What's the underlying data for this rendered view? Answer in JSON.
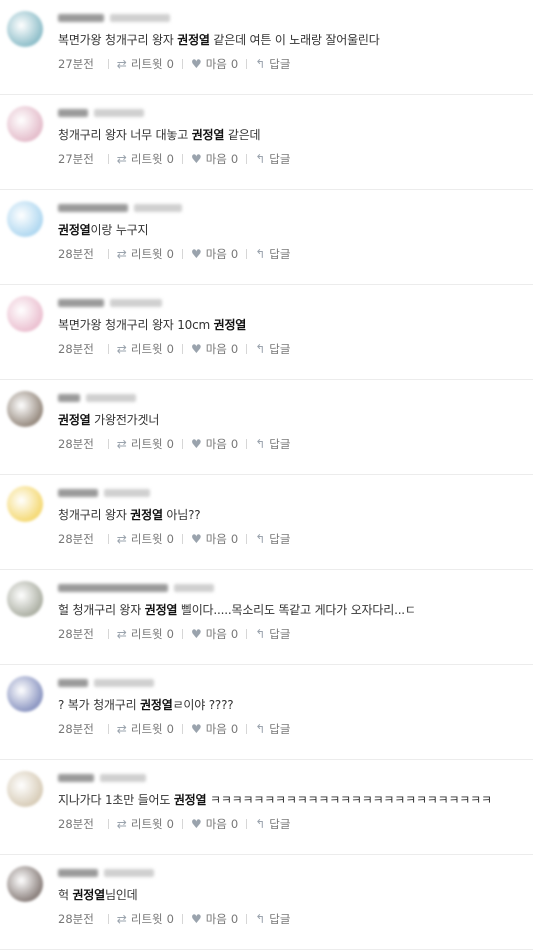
{
  "actions": {
    "retweet_label": "리트윗",
    "like_label": "마음",
    "reply_label": "답글"
  },
  "tweets": [
    {
      "time": "27분전",
      "pre": "복면가왕 청개구리 왕자 ",
      "bold": "권정열",
      "post": " 같은데 여튼 이 노래랑 잘어울린다",
      "retweets": "0",
      "likes": "0",
      "avatar": "#5fa3b3"
    },
    {
      "time": "27분전",
      "pre": "청개구리 왕자 너무 대놓고 ",
      "bold": "권정열",
      "post": " 같은데",
      "retweets": "0",
      "likes": "0",
      "avatar": "#d9a1b5"
    },
    {
      "time": "28분전",
      "pre": "",
      "bold": "권정열",
      "post": "이랑 누구지",
      "retweets": "0",
      "likes": "0",
      "avatar": "#8ec7ea"
    },
    {
      "time": "28분전",
      "pre": "복면가왕 청개구리 왕자 10cm ",
      "bold": "권정열",
      "post": "",
      "retweets": "0",
      "likes": "0",
      "avatar": "#e3a6bd"
    },
    {
      "time": "28분전",
      "pre": "",
      "bold": "권정열",
      "post": " 가왕전가겟너",
      "retweets": "0",
      "likes": "0",
      "avatar": "#6b5a4a"
    },
    {
      "time": "28분전",
      "pre": "청개구리 왕자 ",
      "bold": "권정열",
      "post": " 아님??",
      "retweets": "0",
      "likes": "0",
      "avatar": "#f0c93a"
    },
    {
      "time": "28분전",
      "pre": "헐 청개구리 왕자 ",
      "bold": "권정열",
      "post": " 삘이다.....목소리도 똑같고 게다가 오자다리...ㄷ",
      "retweets": "0",
      "likes": "0",
      "avatar": "#8a8f7e"
    },
    {
      "time": "28분전",
      "pre": "? 복가 청개구리 ",
      "bold": "권정열",
      "post": "ㄹ이야 ????",
      "retweets": "0",
      "likes": "0",
      "avatar": "#5b6aa8"
    },
    {
      "time": "28분전",
      "pre": "지나가다 1초만 들어도 ",
      "bold": "권정열",
      "post": " ㅋㅋㅋㅋㅋㅋㅋㅋㅋㅋㅋㅋㅋㅋㅋㅋㅋㅋㅋㅋㅋㅋㅋㅋㅋㅋ",
      "retweets": "0",
      "likes": "0",
      "avatar": "#c7b79a"
    },
    {
      "time": "28분전",
      "pre": "헉 ",
      "bold": "권정열",
      "post": "님인데",
      "retweets": "0",
      "likes": "0",
      "avatar": "#5a4b46"
    }
  ]
}
